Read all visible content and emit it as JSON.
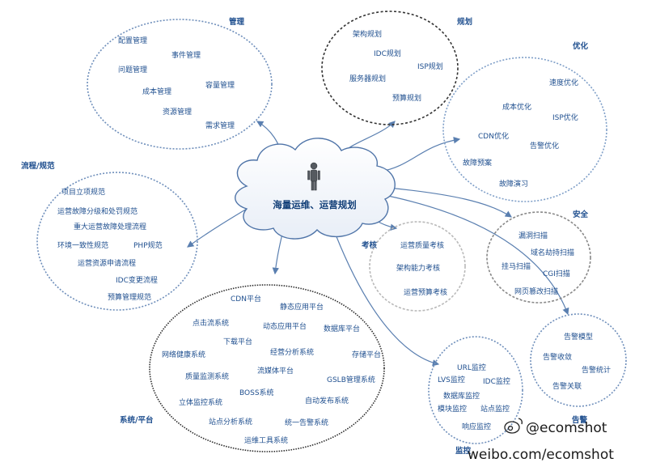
{
  "center": {
    "title": "海量运维、运营规划"
  },
  "groups": {
    "management": {
      "title": "管理",
      "items": [
        "配置管理",
        "事件管理",
        "问题管理",
        "成本管理",
        "容量管理",
        "资源管理",
        "需求管理"
      ]
    },
    "planning": {
      "title": "规划",
      "items": [
        "架构规划",
        "IDC规划",
        "ISP规划",
        "服务器规划",
        "预算规划"
      ]
    },
    "optimization": {
      "title": "优化",
      "items": [
        "速度优化",
        "成本优化",
        "ISP优化",
        "CDN优化",
        "告警优化",
        "故障预案",
        "故障演习"
      ]
    },
    "process": {
      "title": "流程/规范",
      "items": [
        "项目立项规范",
        "运营故障分级和处罚规范",
        "重大运营故障处理流程",
        "环境一致性规范",
        "PHP规范",
        "运营资源申请流程",
        "IDC变更流程",
        "预算管理规范"
      ]
    },
    "assessment": {
      "title": "考核",
      "items": [
        "运营质量考核",
        "架构能力考核",
        "运营预算考核"
      ]
    },
    "security": {
      "title": "安全",
      "items": [
        "漏洞扫描",
        "域名劫持扫描",
        "挂马扫描",
        "CGI扫描",
        "网页篡改扫描"
      ]
    },
    "systems": {
      "title": "系统/平台",
      "items": [
        "CDN平台",
        "静态应用平台",
        "点击流系统",
        "动态应用平台",
        "数据库平台",
        "下载平台",
        "网络健康系统",
        "经营分析系统",
        "存储平台",
        "质量监测系统",
        "流媒体平台",
        "GSLB管理系统",
        "BOSS系统",
        "自动发布系统",
        "立体监控系统",
        "站点分析系统",
        "统一告警系统",
        "运维工具系统"
      ]
    },
    "monitoring": {
      "title": "监控",
      "items": [
        "URL监控",
        "LVS监控",
        "IDC监控",
        "数据库监控",
        "模块监控",
        "站点监控",
        "响应监控"
      ]
    },
    "alerting": {
      "title": "告警",
      "items": [
        "告警模型",
        "告警收敛",
        "告警统计",
        "告警关联"
      ]
    }
  },
  "watermark": {
    "handle": "@ecomshot",
    "url": "weibo.com/ecomshot"
  }
}
